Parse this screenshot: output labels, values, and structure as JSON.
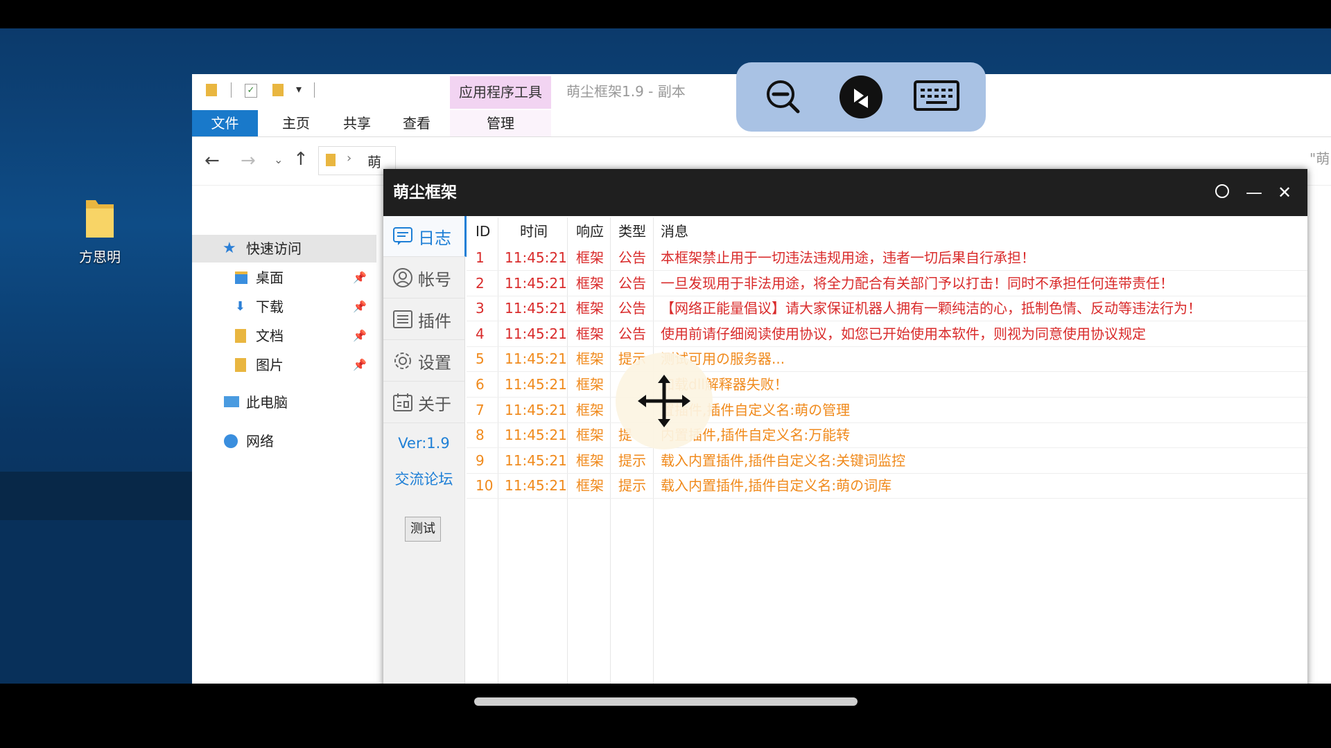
{
  "desktop": {
    "icon_label": "方思明"
  },
  "explorer": {
    "app_tools_tab": "应用程序工具",
    "window_title": "萌尘框架1.9 - 副本",
    "tabs": [
      "文件",
      "主页",
      "共享",
      "查看"
    ],
    "manage_tab": "管理",
    "address_crumb": "萌",
    "right_edge_text": "\"萌",
    "nav": {
      "quick_access": "快速访问",
      "desktop": "桌面",
      "downloads": "下载",
      "documents": "文档",
      "pictures": "图片",
      "this_pc": "此电脑",
      "network": "网络"
    }
  },
  "app": {
    "title": "萌尘框架",
    "sidebar": {
      "log": "日志",
      "account": "帐号",
      "plugins": "插件",
      "settings": "设置",
      "about": "关于",
      "version": "Ver:1.9",
      "forum": "交流论坛",
      "test_button": "测试"
    },
    "columns": [
      "ID",
      "时间",
      "响应",
      "类型",
      "消息"
    ],
    "rows": [
      {
        "id": "1",
        "time": "11:45:21",
        "resp": "框架",
        "type": "公告",
        "msg": "本框架禁止用于一切违法违规用途，违者一切后果自行承担！",
        "color": "#d92b2b"
      },
      {
        "id": "2",
        "time": "11:45:21",
        "resp": "框架",
        "type": "公告",
        "msg": "一旦发现用于非法用途，将全力配合有关部门予以打击！同时不承担任何连带责任！",
        "color": "#d92b2b"
      },
      {
        "id": "3",
        "time": "11:45:21",
        "resp": "框架",
        "type": "公告",
        "msg": "【网络正能量倡议】请大家保证机器人拥有一颗纯洁的心，抵制色情、反动等违法行为！",
        "color": "#d92b2b"
      },
      {
        "id": "4",
        "time": "11:45:21",
        "resp": "框架",
        "type": "公告",
        "msg": "使用前请仔细阅读使用协议，如您已开始使用本软件，则视为同意使用协议规定",
        "color": "#d92b2b"
      },
      {
        "id": "5",
        "time": "11:45:21",
        "resp": "框架",
        "type": "提示",
        "msg": "测试可用の服务器...",
        "color": "#f08a1c"
      },
      {
        "id": "6",
        "time": "11:45:21",
        "resp": "框架",
        "type": "",
        "msg": "加载dll解释器失败！",
        "color": "#f08a1c"
      },
      {
        "id": "7",
        "time": "11:45:21",
        "resp": "框架",
        "type": "",
        "msg": "置插件,插件自定义名:萌の管理",
        "color": "#f08a1c"
      },
      {
        "id": "8",
        "time": "11:45:21",
        "resp": "框架",
        "type": "提",
        "msg": "内置插件,插件自定义名:万能转",
        "color": "#f08a1c"
      },
      {
        "id": "9",
        "time": "11:45:21",
        "resp": "框架",
        "type": "提示",
        "msg": "载入内置插件,插件自定义名:关键词监控",
        "color": "#f08a1c"
      },
      {
        "id": "10",
        "time": "11:45:21",
        "resp": "框架",
        "type": "提示",
        "msg": "载入内置插件,插件自定义名:萌の词库",
        "color": "#f08a1c"
      }
    ]
  },
  "overlay": {
    "icons": [
      "zoom-out-icon",
      "remote-desktop-icon",
      "keyboard-icon",
      "move-icon"
    ]
  }
}
